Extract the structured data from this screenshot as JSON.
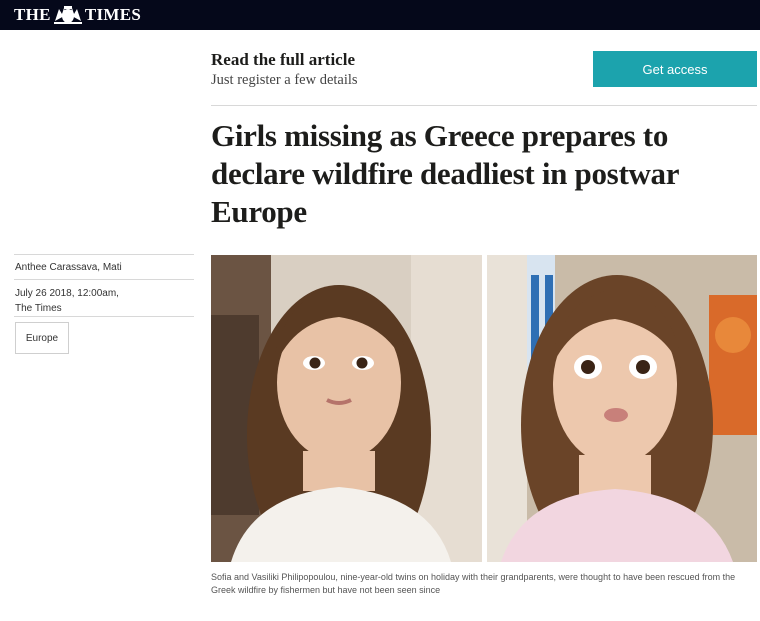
{
  "masthead": {
    "logo_left": "THE",
    "logo_right": "TIMES"
  },
  "promo": {
    "title": "Read the full article",
    "subtitle": "Just register a few details",
    "cta_label": "Get access"
  },
  "article": {
    "headline": "Girls missing as Greece prepares to declare wildfire deadliest in postwar Europe",
    "author_location": "Anthee Carassava, Mati",
    "date": "July 26 2018, 12:00am,",
    "publication": "The Times",
    "tag": "Europe",
    "caption": "Sofia and Vasiliki Philipopoulou, nine-year-old twins on holiday with their grandparents, were thought to have been rescued from the Greek wildfire by fishermen but have not been seen since"
  },
  "colors": {
    "masthead_bg": "#05081a",
    "cta_bg": "#1ca3ad"
  }
}
